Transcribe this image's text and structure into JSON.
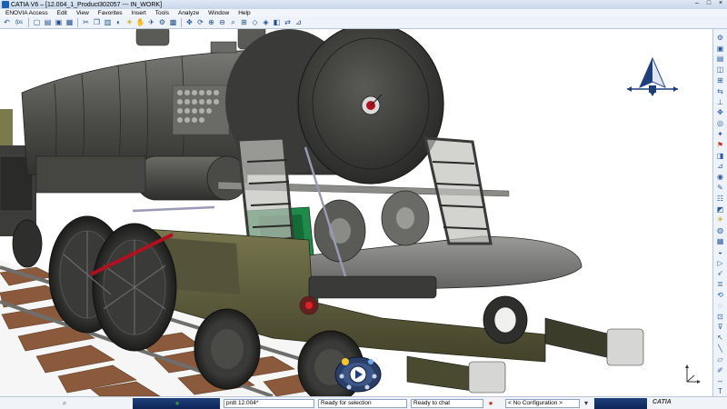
{
  "window": {
    "title": "CATIA V6 – [12.004_1_Product302057 --- IN_WORK]",
    "controls": [
      "–",
      "□",
      "×"
    ]
  },
  "menu": {
    "items": [
      "ENOVIA Access",
      "Edit",
      "View",
      "Favorites",
      "Insert",
      "Tools",
      "Analyze",
      "Window",
      "Help"
    ]
  },
  "toolbar": {
    "items": [
      "undo-icon",
      "fps-icon",
      "save-icon",
      "open-icon",
      "new-icon",
      "cut-icon",
      "copy-icon",
      "paste-icon",
      "render-icon",
      "hand-icon",
      "fly-icon",
      "zoom-in-icon",
      "zoom-out-icon",
      "zoom-area-icon",
      "rotate-icon",
      "normal-view-icon",
      "iso-view-icon",
      "shading-icon",
      "hide-show-icon",
      "swap-icon"
    ],
    "fps_label": "fps"
  },
  "right_toolbar": {
    "count": 38
  },
  "status": {
    "product_field": "prdt 12.004*",
    "selection_field": "Ready for selection",
    "chat_field": "Ready to chat",
    "config_field": "< No Configuration >",
    "brand": "CATIA"
  },
  "colors": {
    "accent": "#1f3f7a",
    "loco_body": "#4a4a46",
    "loco_green": "#1f8a4a",
    "loco_olive": "#5f5e3c",
    "rail": "#8b5a3c"
  }
}
